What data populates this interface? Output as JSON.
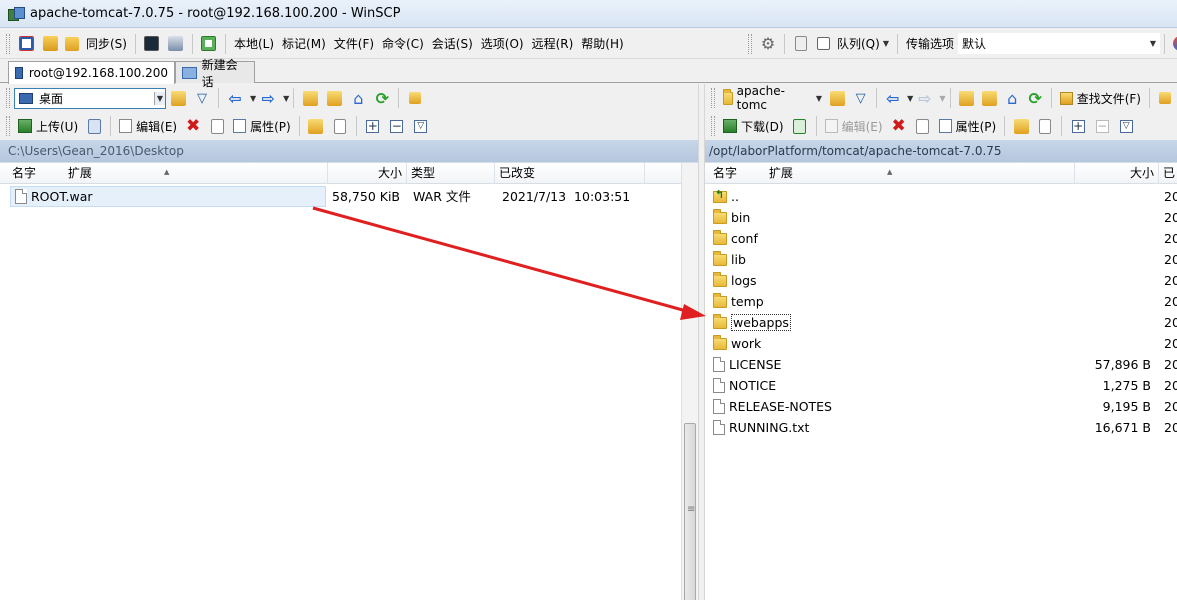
{
  "window": {
    "title": "apache-tomcat-7.0.75 - root@192.168.100.200 - WinSCP"
  },
  "menubar": {
    "sync_label": "同步(S)",
    "menus": [
      "本地(L)",
      "标记(M)",
      "文件(F)",
      "命令(C)",
      "会话(S)",
      "选项(O)",
      "远程(R)",
      "帮助(H)"
    ],
    "queue_label": "队列(Q)",
    "transfer_options_label": "传输选项",
    "transfer_preset": "默认"
  },
  "tabs": {
    "session": "root@192.168.100.200",
    "new_session": "新建会话"
  },
  "left": {
    "location": "桌面",
    "actions": {
      "upload": "上传(U)",
      "edit": "编辑(E)",
      "properties": "属性(P)"
    },
    "path": "C:\\Users\\Gean_2016\\Desktop",
    "columns": {
      "name": "名字",
      "ext": "扩展",
      "size": "大小",
      "type": "类型",
      "modified": "已改变"
    },
    "files": [
      {
        "name": "ROOT.war",
        "size": "58,750 KiB",
        "type": "WAR 文件",
        "modified": "2021/7/13  10:03:51"
      }
    ]
  },
  "right": {
    "location": "apache-tomc",
    "find_files": "查找文件(F)",
    "actions": {
      "download": "下载(D)",
      "edit": "编辑(E)",
      "properties": "属性(P)"
    },
    "path": "/opt/laborPlatform/tomcat/apache-tomcat-7.0.75",
    "columns": {
      "name": "名字",
      "ext": "扩展",
      "size": "大小",
      "modified": "已"
    },
    "files": [
      {
        "name": "..",
        "kind": "up",
        "size": "",
        "modified": "20"
      },
      {
        "name": "bin",
        "kind": "folder",
        "size": "",
        "modified": "20"
      },
      {
        "name": "conf",
        "kind": "folder",
        "size": "",
        "modified": "20"
      },
      {
        "name": "lib",
        "kind": "folder",
        "size": "",
        "modified": "20"
      },
      {
        "name": "logs",
        "kind": "folder",
        "size": "",
        "modified": "20"
      },
      {
        "name": "temp",
        "kind": "folder",
        "size": "",
        "modified": "20"
      },
      {
        "name": "webapps",
        "kind": "folder",
        "size": "",
        "modified": "20"
      },
      {
        "name": "work",
        "kind": "folder",
        "size": "",
        "modified": "20"
      },
      {
        "name": "LICENSE",
        "kind": "file",
        "size": "57,896 B",
        "modified": "20"
      },
      {
        "name": "NOTICE",
        "kind": "file",
        "size": "1,275 B",
        "modified": "20"
      },
      {
        "name": "RELEASE-NOTES",
        "kind": "file",
        "size": "9,195 B",
        "modified": "20"
      },
      {
        "name": "RUNNING.txt",
        "kind": "file",
        "size": "16,671 B",
        "modified": "20"
      }
    ]
  },
  "colors": {
    "annotation_arrow": "#e02020",
    "path_bar": "#c7d6e8"
  }
}
